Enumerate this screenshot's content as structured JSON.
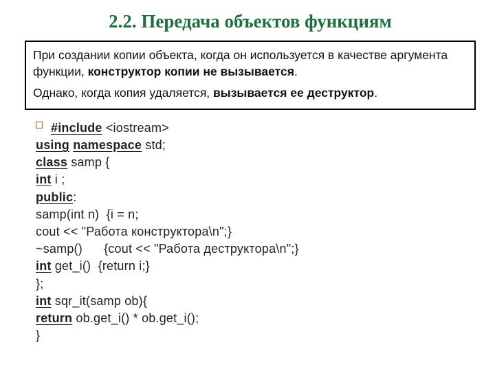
{
  "title": "2.2. Передача объектов функциям",
  "callout": {
    "p1_plain1": "При создании копии объекта, когда он используется в качестве аргумента функции, ",
    "p1_bold": "конструктор копии не вызывается",
    "p1_tail": ".",
    "p2_plain1": "Однако, когда копия удаляется, ",
    "p2_bold": "вызывается ее деструктор",
    "p2_tail": "."
  },
  "code": {
    "l1_kw": "#include",
    "l1_rest": " <iostream>",
    "l2_kw1": "using",
    "l2_sp": " ",
    "l2_kw2": "namespace",
    "l2_rest": " std;",
    "l3_kw": "class",
    "l3_rest": " samp {",
    "l4_kw": "int",
    "l4_rest": " i ;",
    "l5_kw": "public",
    "l5_rest": ":",
    "l6": "samp(int n)  {i = n;",
    "l7": "cout << \"Работа конструктора\\n\";}",
    "l8": "~samp()      {cout << \"Работа деструктора\\n\";}",
    "l9_kw": "int",
    "l9_rest": " get_i()  {return i;}",
    "l10": "};",
    "l11_kw": "int",
    "l11_rest": " sqr_it(samp ob){",
    "l12_kw": "return",
    "l12_rest": " ob.get_i() * ob.get_i();",
    "l13": "}"
  }
}
